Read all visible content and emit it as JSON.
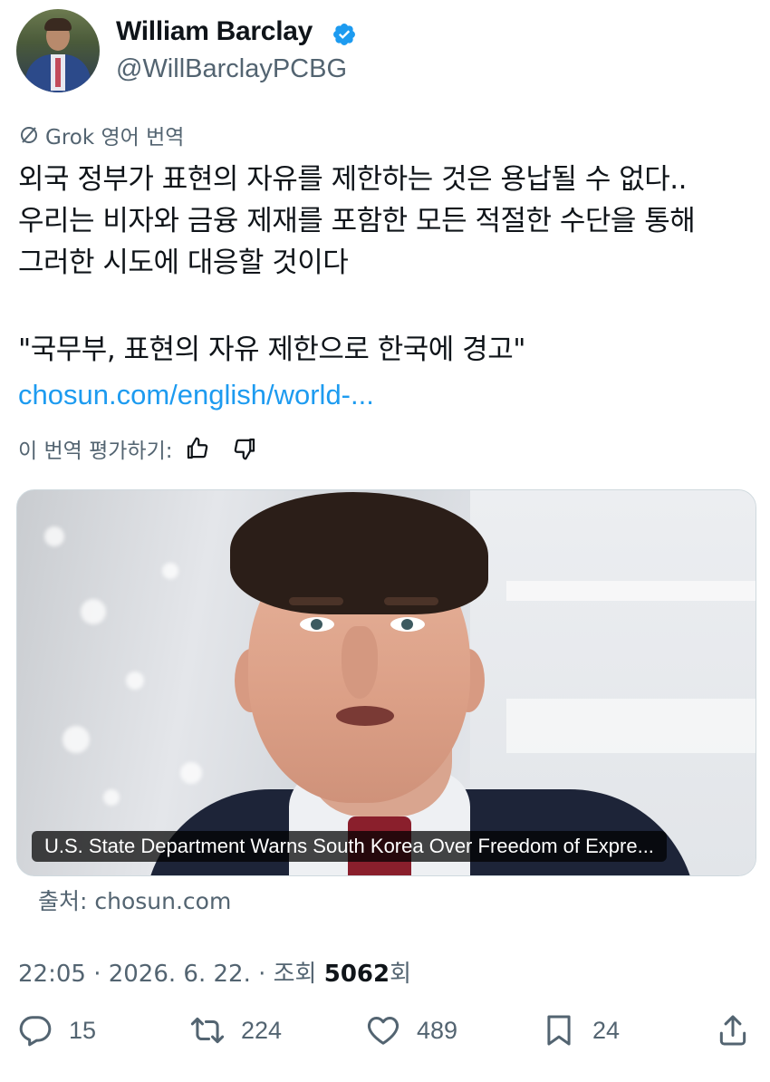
{
  "author": {
    "name": "William Barclay",
    "handle": "@WillBarclayPCBG"
  },
  "translation": {
    "label": "Grok 영어 번역"
  },
  "tweet": {
    "lines": [
      "외국 정부가 표현의 자유를 제한하는 것은 용납될 수 없다..",
      "우리는 비자와 금융 제재를 포함한 모든 적절한 수단을 통해",
      "그러한 시도에 대응할 것이다",
      "\"국무부, 표현의 자유 제한으로 한국에 경고\""
    ],
    "link": "chosun.com/english/world-..."
  },
  "rating": {
    "label": "이 번역 평가하기:"
  },
  "card": {
    "caption": "U.S. State Department Warns South Korea Over Freedom of Expre...",
    "source": "출처: chosun.com"
  },
  "meta": {
    "time_date": "22:05 · 2026. 6. 22. · 조회 ",
    "views": "5062",
    "views_suffix": "회"
  },
  "actions": {
    "replies": "15",
    "reposts": "224",
    "likes": "489",
    "bookmarks": "24"
  },
  "colors": {
    "verified": "#1d9bf0",
    "link": "#1d9bf0",
    "muted": "#536471"
  },
  "icons": [
    "verified-badge-icon",
    "grok-icon",
    "thumbs-up-icon",
    "thumbs-down-icon",
    "reply-icon",
    "repost-icon",
    "like-icon",
    "bookmark-icon",
    "share-icon"
  ]
}
